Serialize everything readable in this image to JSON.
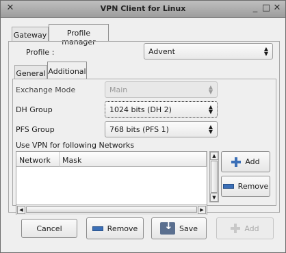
{
  "window": {
    "title": "VPN Client for Linux"
  },
  "top_tabs": [
    {
      "label": "Gateway"
    },
    {
      "label": "Profile manager"
    }
  ],
  "profile": {
    "label": "Profile :",
    "value": "Advent"
  },
  "sub_tabs": [
    {
      "label": "General"
    },
    {
      "label": "Additional"
    }
  ],
  "fields": {
    "exchange_mode": {
      "label": "Exchange Mode",
      "value": "Main"
    },
    "dh_group": {
      "label": "DH Group",
      "value": "1024 bits (DH 2)"
    },
    "pfs_group": {
      "label": "PFS Group",
      "value": "768 bits (PFS 1)"
    }
  },
  "networks": {
    "label": "Use VPN for following Networks",
    "columns": [
      "Network",
      "Mask"
    ],
    "rows": [],
    "add_label": "Add",
    "remove_label": "Remove"
  },
  "footer": {
    "cancel_label": "Cancel",
    "remove_label": "Remove",
    "save_label": "Save",
    "add_label": "Add"
  }
}
